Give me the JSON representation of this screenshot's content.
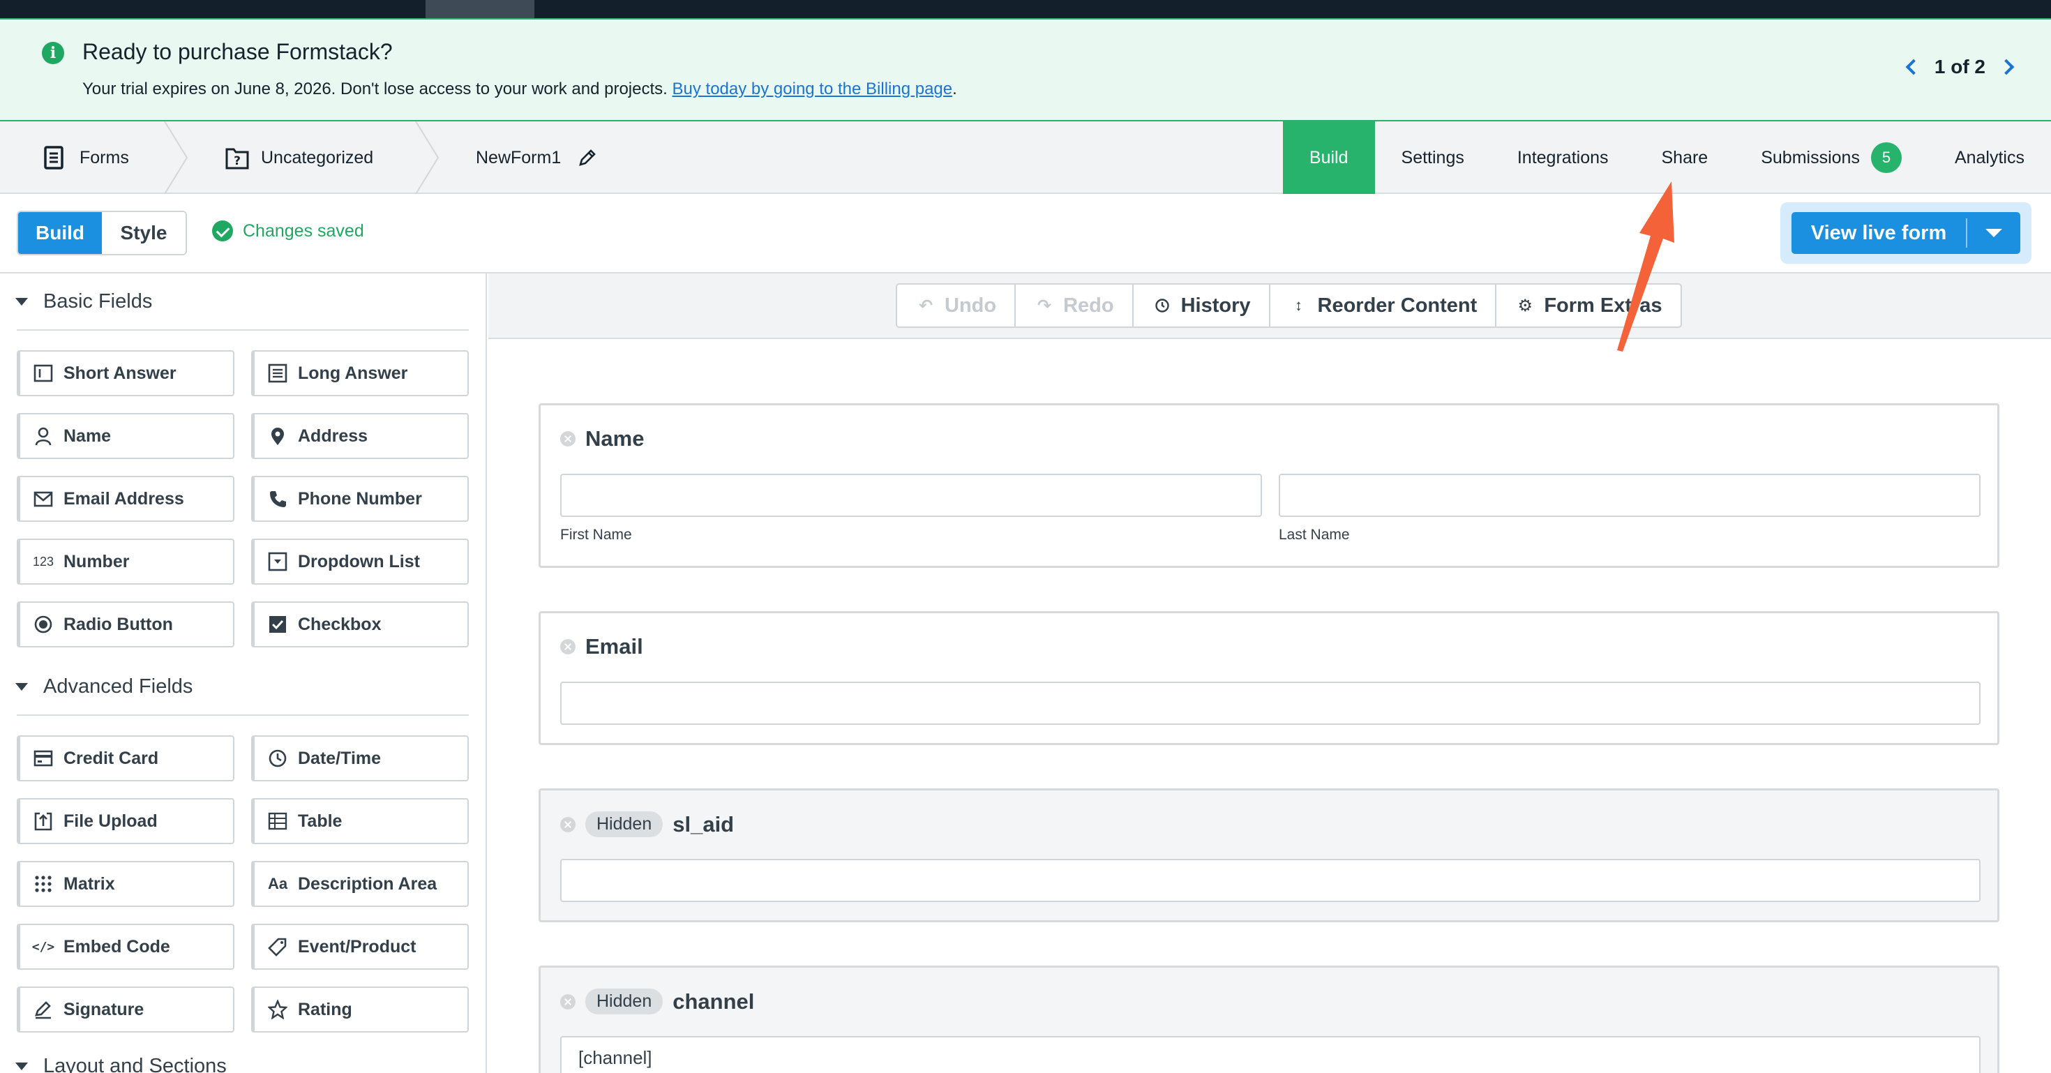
{
  "banner": {
    "title": "Ready to purchase Formstack?",
    "message": "Your trial expires on June 8, 2026. Don't lose access to your work and projects.",
    "link": "Buy today by going to the Billing page",
    "period": ".",
    "pager": "1 of 2"
  },
  "breadcrumb": {
    "forms": "Forms",
    "folder": "Uncategorized",
    "form_name": "NewForm1"
  },
  "nav_tabs": {
    "build": "Build",
    "settings": "Settings",
    "integrations": "Integrations",
    "share": "Share",
    "submissions": "Submissions",
    "submissions_count": "5",
    "analytics": "Analytics"
  },
  "toolbar": {
    "build": "Build",
    "style": "Style",
    "status": "Changes saved",
    "view_live": "View live form"
  },
  "sidebar": {
    "basic_title": "Basic Fields",
    "basic": [
      "Short Answer",
      "Long Answer",
      "Name",
      "Address",
      "Email Address",
      "Phone Number",
      "Number",
      "Dropdown List",
      "Radio Button",
      "Checkbox"
    ],
    "advanced_title": "Advanced Fields",
    "advanced": [
      "Credit Card",
      "Date/Time",
      "File Upload",
      "Table",
      "Matrix",
      "Description Area",
      "Embed Code",
      "Event/Product",
      "Signature",
      "Rating"
    ],
    "layout_title": "Layout and Sections"
  },
  "canvas_toolbar": {
    "undo": "Undo",
    "redo": "Redo",
    "history": "History",
    "reorder": "Reorder Content",
    "extras": "Form Extras"
  },
  "fields": {
    "name": {
      "label": "Name",
      "first": "First Name",
      "last": "Last Name"
    },
    "email": {
      "label": "Email"
    },
    "sl_aid": {
      "tag": "Hidden",
      "label": "sl_aid"
    },
    "channel": {
      "tag": "Hidden",
      "label": "channel",
      "value": "[channel]"
    }
  },
  "colors": {
    "brand_green": "#27b36c",
    "primary_blue": "#1b8fe0",
    "annotation_arrow": "#f4623a"
  }
}
